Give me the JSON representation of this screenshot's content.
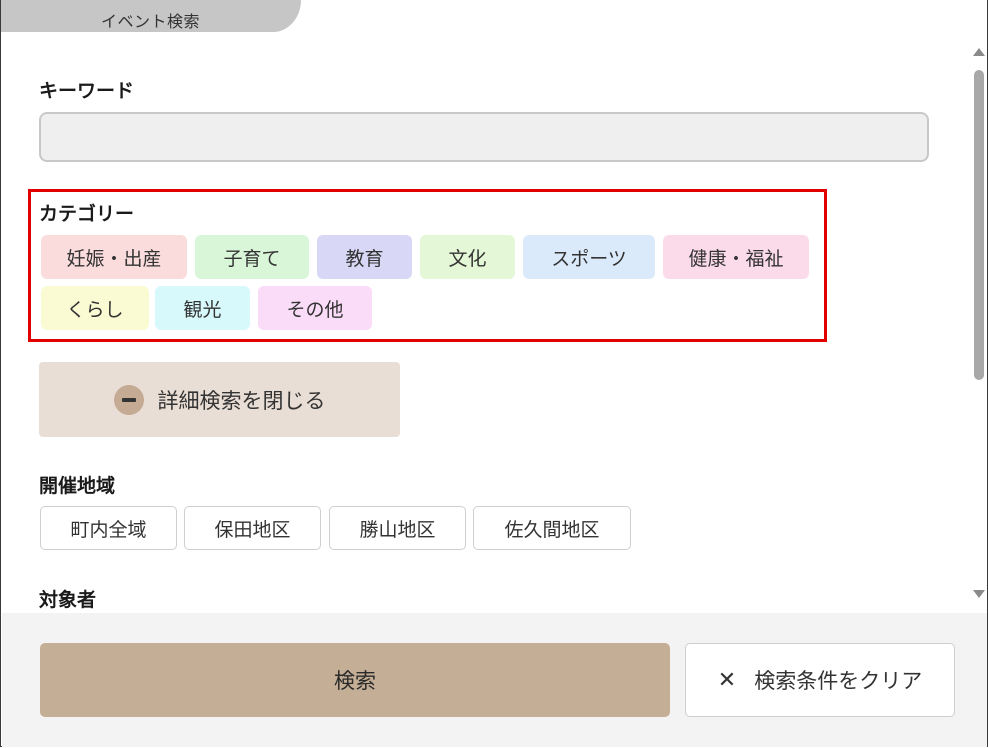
{
  "header": {
    "tab_label": "イベント検索"
  },
  "keyword": {
    "label": "キーワード",
    "value": "",
    "placeholder": ""
  },
  "category": {
    "label": "カテゴリー",
    "chips": [
      {
        "label": "妊娠・出産",
        "color": "#fbdcdc"
      },
      {
        "label": "子育て",
        "color": "#d9f6d9"
      },
      {
        "label": "教育",
        "color": "#d8d8f6"
      },
      {
        "label": "文化",
        "color": "#e4f7d6"
      },
      {
        "label": "スポーツ",
        "color": "#dbeafb"
      },
      {
        "label": "健康・福祉",
        "color": "#fbdbea"
      },
      {
        "label": "くらし",
        "color": "#fafbd3"
      },
      {
        "label": "観光",
        "color": "#d8f9fb"
      },
      {
        "label": "その他",
        "color": "#fadbf8"
      }
    ]
  },
  "detail_toggle": {
    "label": "詳細検索を閉じる",
    "icon": "minus-circle-icon"
  },
  "region": {
    "label": "開催地域",
    "chips": [
      "町内全域",
      "保田地区",
      "勝山地区",
      "佐久間地区"
    ]
  },
  "target": {
    "label": "対象者"
  },
  "footer": {
    "search_label": "検索",
    "clear_label": "検索条件をクリア",
    "clear_icon": "close-icon"
  },
  "colors": {
    "highlight_border": "#e00000",
    "search_button": "#c5ae96",
    "toggle_button": "#e9ded5"
  }
}
